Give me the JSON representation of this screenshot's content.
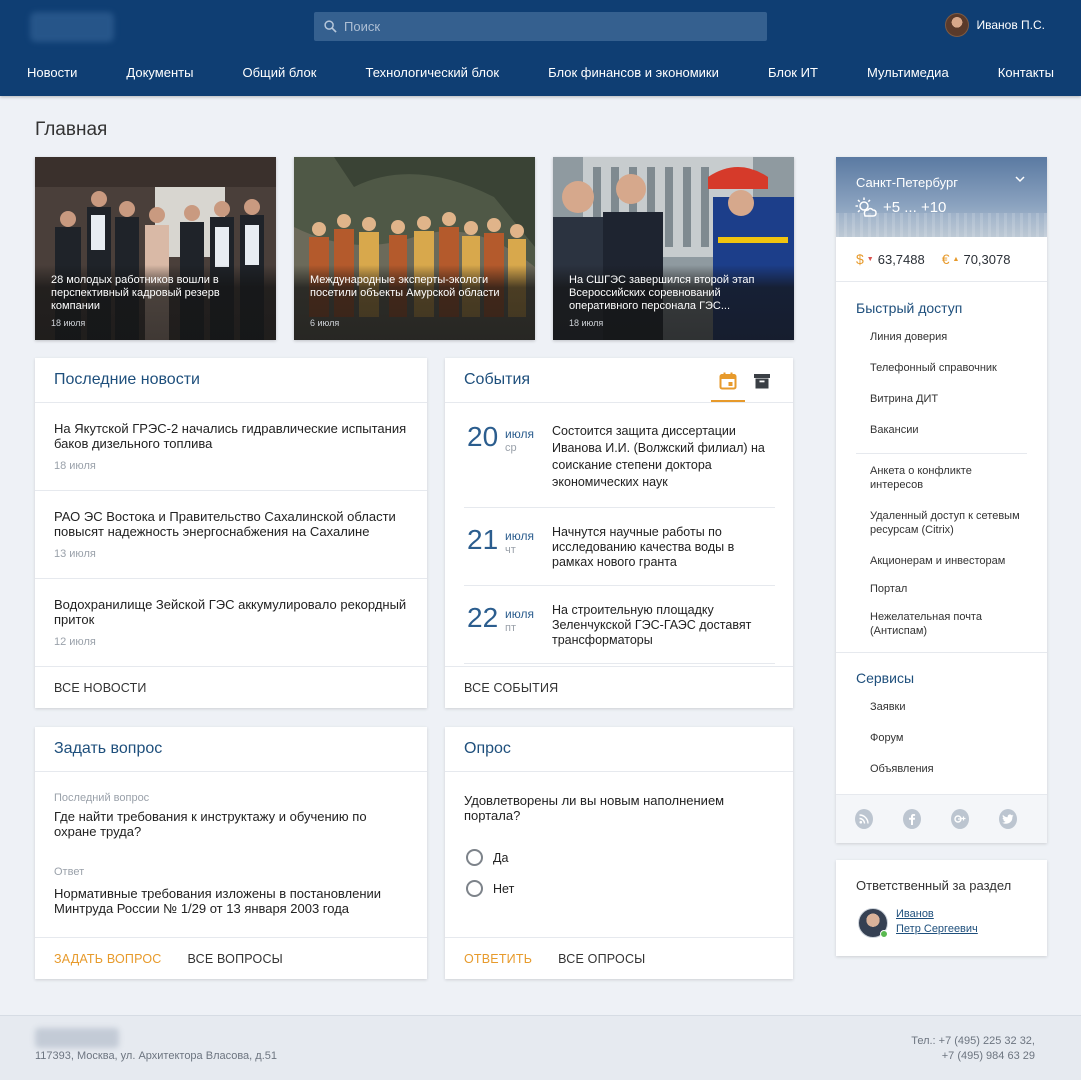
{
  "header": {
    "search_placeholder": "Поиск",
    "user_name": "Иванов П.С.",
    "nav": [
      "Новости",
      "Документы",
      "Общий блок",
      "Технологический блок",
      "Блок финансов и экономики",
      "Блок ИТ",
      "Мультимедиа",
      "Контакты"
    ]
  },
  "page_title": "Главная",
  "hero_news": [
    {
      "caption": "28 молодых работников вошли в перспективный кадровый резерв компании",
      "date": "18 июля"
    },
    {
      "caption": "Международные эксперты-экологи посетили объекты Амурской области",
      "date": "6 июля"
    },
    {
      "caption": "На СШГЭС завершился второй этап Всероссийских соревнований оперативного персонала ГЭС...",
      "date": "18 июля"
    }
  ],
  "latest_news": {
    "title": "Последние новости",
    "items": [
      {
        "text": "На Якутской ГРЭС-2 начались гидравлические испытания баков дизельного топлива",
        "date": "18 июля"
      },
      {
        "text": "РАО ЭС Востока и Правительство Сахалинской области повысят надежность энергоснабжения на Сахалине",
        "date": "13 июля"
      },
      {
        "text": "Водохранилище Зейской ГЭС аккумулировало рекордный приток",
        "date": "12 июля"
      }
    ],
    "all_label": "ВСЕ НОВОСТИ"
  },
  "events": {
    "title": "События",
    "items": [
      {
        "day": "20",
        "month": "июля",
        "weekday": "ср",
        "text": "Состоится защита диссертации Иванова И.И. (Волжский филиал) на соискание степени доктора экономических наук"
      },
      {
        "day": "21",
        "month": "июля",
        "weekday": "чт",
        "text": "Начнутся научные работы по исследованию качества воды в рамках нового гранта"
      },
      {
        "day": "22",
        "month": "июля",
        "weekday": "пт",
        "text": "На строительную площадку Зеленчукской ГЭС-ГАЭС доставят трансформаторы"
      }
    ],
    "all_label": "ВСЕ СОБЫТИЯ"
  },
  "ask": {
    "title": "Задать вопрос",
    "last_question_label": "Последний вопрос",
    "last_question": "Где найти требования к инструктажу и обучению по охране труда?",
    "answer_label": "Ответ",
    "answer": "Нормативные требования изложены в постановлении Минтруда России № 1/29 от 13 января 2003 года",
    "ask_label": "ЗАДАТЬ ВОПРОС",
    "all_label": "ВСЕ ВОПРОСЫ"
  },
  "poll": {
    "title": "Опрос",
    "question": "Удовлетворены ли вы новым наполнением портала?",
    "options": [
      "Да",
      "Нет"
    ],
    "answer_label": "ОТВЕТИТЬ",
    "all_label": "ВСЕ ОПРОСЫ"
  },
  "sidebar": {
    "city": "Санкт-Петербург",
    "temperature": "+5 ... +10",
    "usd": "63,7488",
    "eur": "70,3078",
    "usd_symbol": "$",
    "eur_symbol": "€",
    "quick_access_title": "Быстрый доступ",
    "quick_links": [
      "Линия доверия",
      "Телефонный справочник",
      "Витрина ДИТ",
      "Вакансии"
    ],
    "quick_links_2": [
      "Анкета о конфликте интересов",
      "Удаленный доступ к сетевым ресурсам (Citrix)",
      "Акционерам и инвесторам",
      "Портал",
      "Нежелательная почта (Антиспам)"
    ],
    "services_title": "Сервисы",
    "services": [
      "Заявки",
      "Форум",
      "Объявления"
    ],
    "social": [
      "rss-icon",
      "facebook-icon",
      "google-plus-icon",
      "twitter-icon"
    ]
  },
  "responsible": {
    "title": "Ответственный за раздел",
    "surname": "Иванов",
    "name": "Петр Сергеевич"
  },
  "footer": {
    "address": "117393, Москва, ул. Архитектора Власова, д.51",
    "phone1": "Тел.: +7 (495) 225 32 32,",
    "phone2": "+7 (495) 984 63 29"
  },
  "colors": {
    "header": "#0f3e73",
    "accent": "#e79a2b",
    "link": "#1e4f7c"
  }
}
